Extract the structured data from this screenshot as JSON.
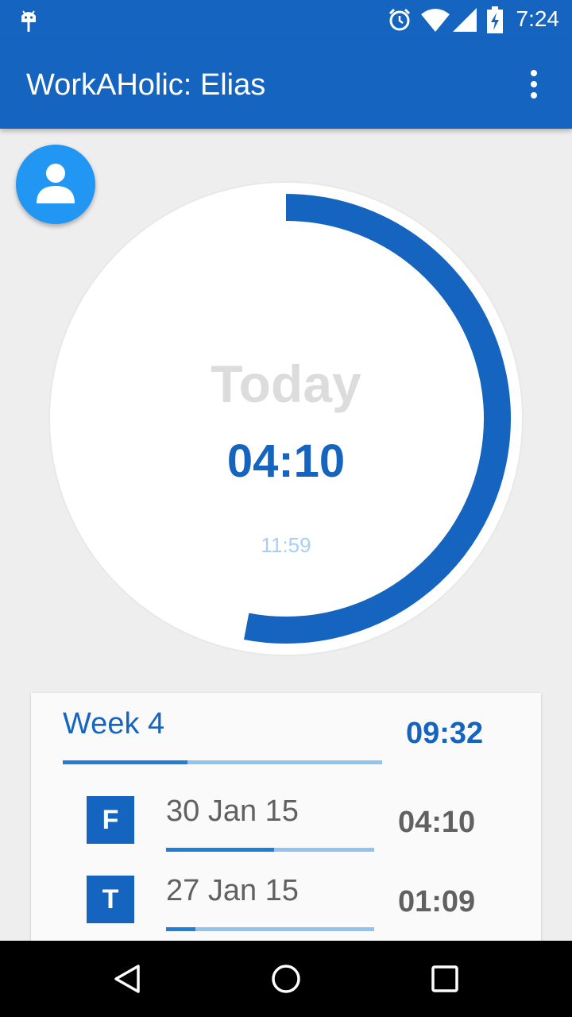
{
  "status_bar": {
    "time": "7:24",
    "icons": [
      "android-icon",
      "alarm-icon",
      "wifi-icon",
      "signal-icon",
      "battery-charging-icon"
    ]
  },
  "app_bar": {
    "title": "WorkAHolic: Elias",
    "menu_icon": "more-vert-icon"
  },
  "fab": {
    "icon": "person-icon"
  },
  "dial": {
    "label": "Today",
    "worked": "04:10",
    "target": "11:59",
    "progress": 0.53,
    "colors": {
      "progress": "#1565c0",
      "label": "#dcdcdc",
      "target": "#a8cff3"
    }
  },
  "week": {
    "label": "Week 4",
    "total": "09:32",
    "progress": 0.39,
    "days": [
      {
        "letter": "F",
        "date": "30 Jan 15",
        "total": "04:10",
        "progress": 0.52
      },
      {
        "letter": "T",
        "date": "27 Jan 15",
        "total": "01:09",
        "progress": 0.14
      }
    ]
  },
  "nav_bar": {
    "icons": [
      "back-icon",
      "home-icon",
      "recents-icon"
    ]
  },
  "colors": {
    "primary": "#1565c0",
    "accent": "#2196f3",
    "bar_track": "#90c4ef",
    "bar_fill": "#1e7fd8"
  }
}
